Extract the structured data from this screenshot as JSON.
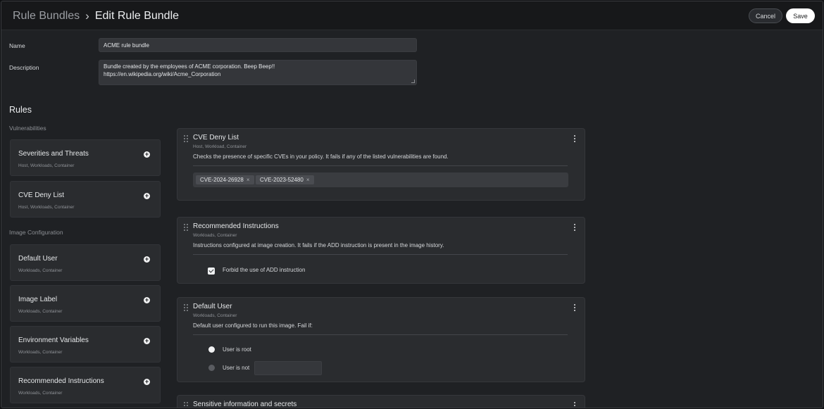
{
  "header": {
    "breadcrumb_parent": "Rule Bundles",
    "breadcrumb_separator": "›",
    "breadcrumb_current": "Edit Rule Bundle",
    "cancel_label": "Cancel",
    "save_label": "Save"
  },
  "form": {
    "name_label": "Name",
    "name_value": "ACME rule bundle",
    "description_label": "Description",
    "description_line1": "Bundle created by the employees of ACME corporation. Beep Beep!!",
    "description_line2": "https://en.wikipedia.org/wiki/Acme_Corporation"
  },
  "rules": {
    "title": "Rules",
    "sections": [
      {
        "label": "Vulnerabilities",
        "items": [
          {
            "title": "Severities and Threats",
            "scope": "Host, Workloads, Container"
          },
          {
            "title": "CVE Deny List",
            "scope": "Host, Workloads, Container"
          }
        ]
      },
      {
        "label": "Image Configuration",
        "items": [
          {
            "title": "Default User",
            "scope": "Workloads, Container"
          },
          {
            "title": "Image Label",
            "scope": "Workloads, Container"
          },
          {
            "title": "Environment Variables",
            "scope": "Workloads, Container"
          },
          {
            "title": "Recommended Instructions",
            "scope": "Workloads, Container"
          }
        ]
      }
    ],
    "add_icon": "plus-circle-icon"
  },
  "selected_rules": {
    "cve_deny_list": {
      "title": "CVE Deny List",
      "scope": "Host, Workload, Container",
      "description": "Checks the presence of specific CVEs in your policy. It fails if any of the listed vulnerabilities are found.",
      "cves": [
        "CVE-2024-26928",
        "CVE-2023-52480"
      ],
      "remove_glyph": "×"
    },
    "recommended_instructions": {
      "title": "Recommended Instructions",
      "scope": "Workloads, Container",
      "description": "Instructions configured at image creation. It fails if the ADD instruction is present in the image history.",
      "forbid_add_label": "Forbid the use of ADD instruction",
      "forbid_add_checked": true
    },
    "default_user": {
      "title": "Default User",
      "scope": "Workloads, Container",
      "description": "Default user configured to run this image. Fail if:",
      "option_root": "User is root",
      "option_not": "User is not",
      "selected": "User is root",
      "user_not_value": ""
    },
    "sensitive_info": {
      "title": "Sensitive information and secrets"
    }
  }
}
